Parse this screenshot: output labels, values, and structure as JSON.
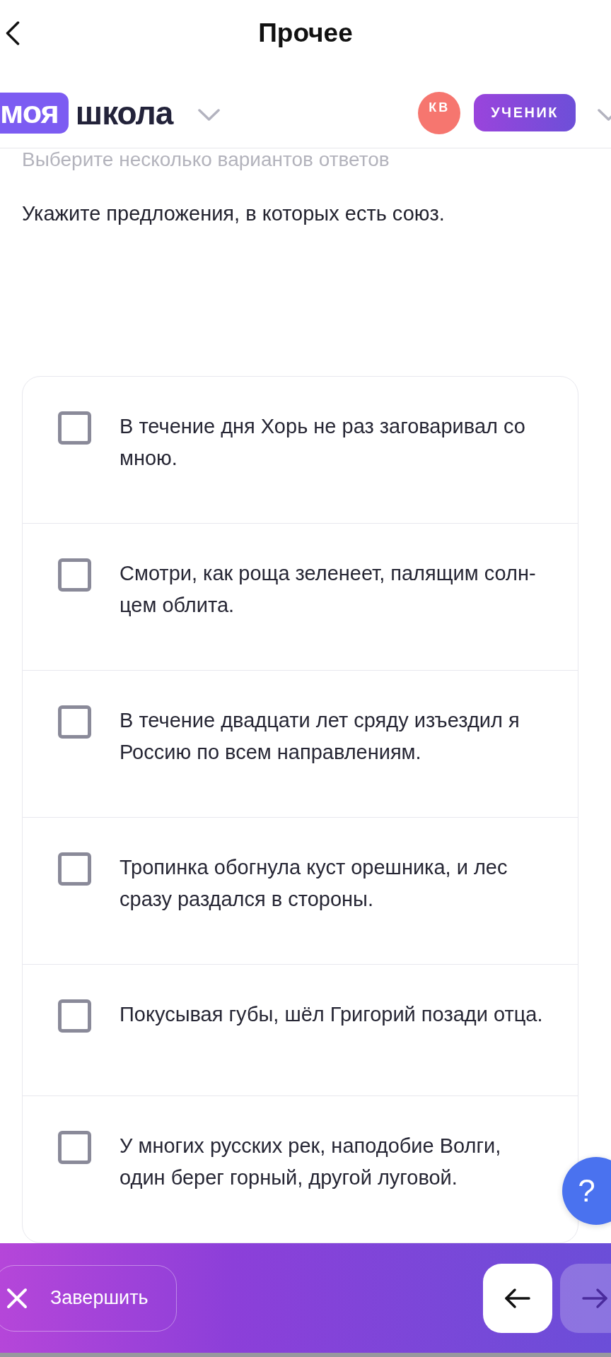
{
  "nav_bar": {
    "title": "Прочее"
  },
  "school_header": {
    "logo": {
      "highlight": "моя",
      "rest": "школа"
    },
    "avatar_initials": "КВ",
    "role_badge": "УЧЕНИК"
  },
  "question": {
    "hint": "Выберите несколько вариантов ответов",
    "prompt": "Укажите предложения, в которых есть союз.",
    "options": [
      {
        "text": "В течение дня Хорь не раз заговаривал со мною.",
        "checked": false
      },
      {
        "text": "Смотри, как роща зеленеет, палящим солн-цем облита.",
        "checked": false
      },
      {
        "text": "В течение двадцати лет сряду изъездил я Россию по всем направлениям.",
        "checked": false
      },
      {
        "text": "Тропинка обогнула куст орешника, и лес сразу раздался в стороны.",
        "checked": false
      },
      {
        "text": "Покусывая губы, шёл Григорий позади отца.",
        "checked": false
      },
      {
        "text": "У многих русских рек, наподобие Волги, один берег горный, другой луговой.",
        "checked": false
      }
    ]
  },
  "help_button": {
    "label": "?"
  },
  "bottom_bar": {
    "finish_button": {
      "label": "Завершить"
    },
    "nav_buttons": [
      {
        "kind": "prev",
        "disabled": false
      },
      {
        "kind": "next",
        "disabled": true
      }
    ]
  }
}
